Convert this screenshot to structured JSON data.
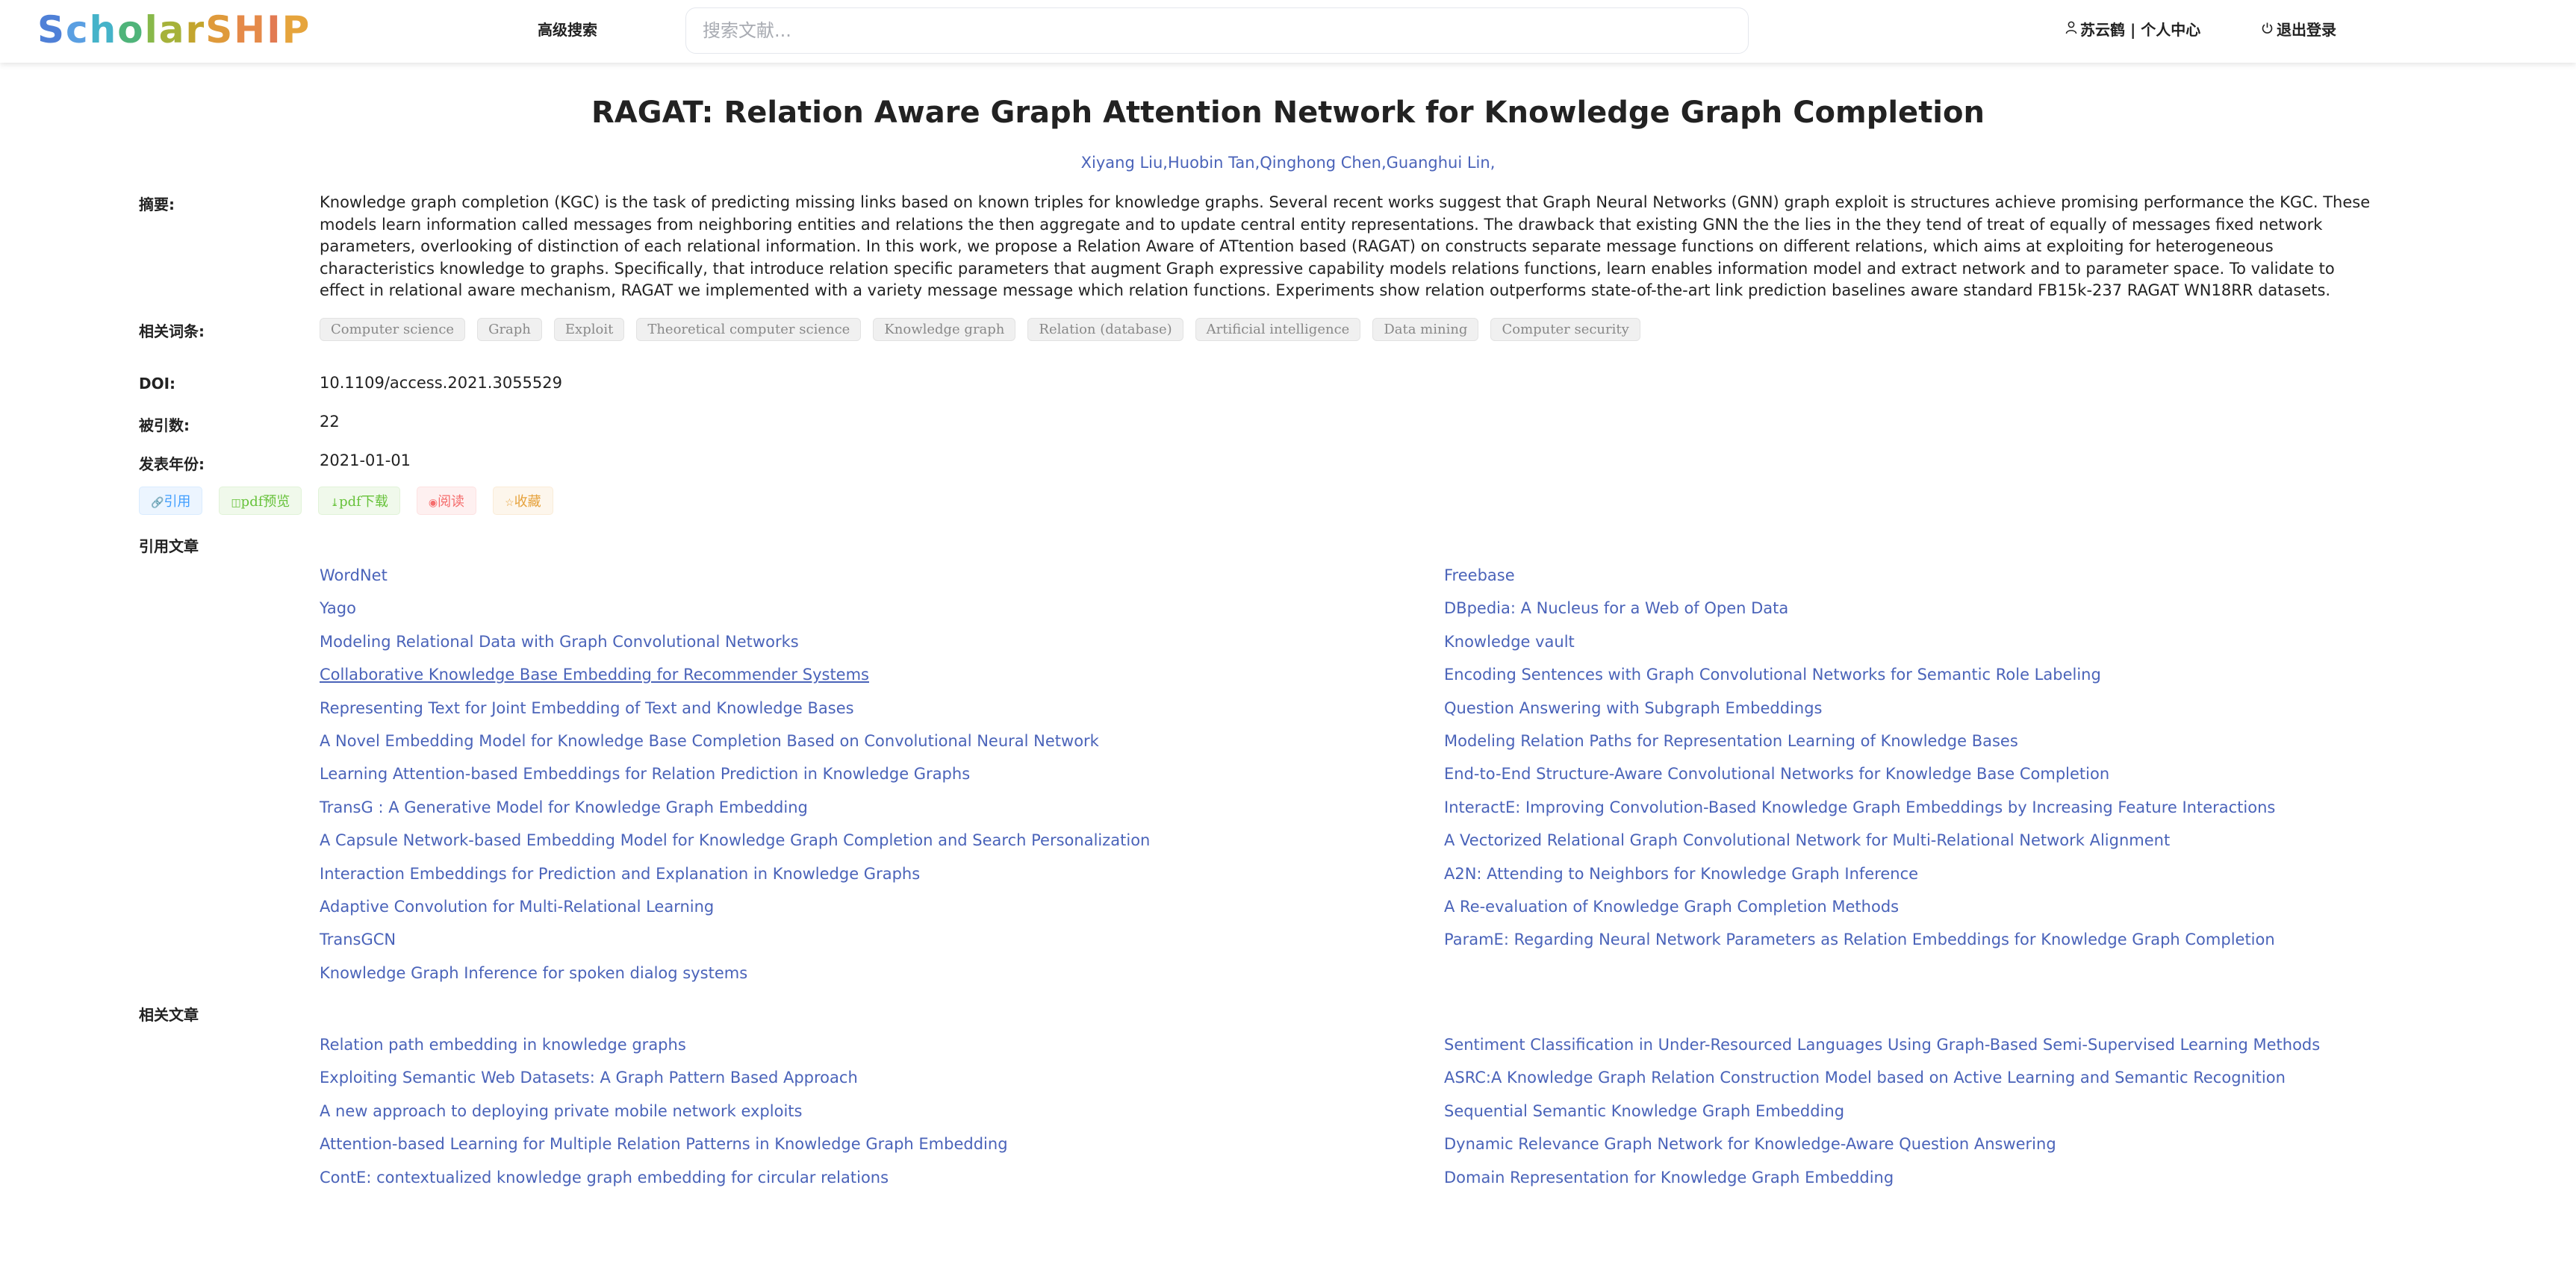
{
  "header": {
    "logo_letters": [
      {
        "ch": "S",
        "color": "#4f80d7"
      },
      {
        "ch": "c",
        "color": "#5a9fe2"
      },
      {
        "ch": "h",
        "color": "#45b3c9"
      },
      {
        "ch": "o",
        "color": "#4fb47a"
      },
      {
        "ch": "l",
        "color": "#88b94a"
      },
      {
        "ch": "a",
        "color": "#a6b23a"
      },
      {
        "ch": "r",
        "color": "#c3a52e"
      },
      {
        "ch": "S",
        "color": "#df9a3b"
      },
      {
        "ch": "H",
        "color": "#e58a49"
      },
      {
        "ch": "I",
        "color": "#e27a52"
      },
      {
        "ch": "P",
        "color": "#e6a43c"
      }
    ],
    "advanced_search": "高级搜索",
    "search_placeholder": "搜索文献...",
    "user_label": "苏云鹤 | 个人中心",
    "logout_label": "退出登录"
  },
  "paper": {
    "title": "RAGAT: Relation Aware Graph Attention Network for Knowledge Graph Completion",
    "authors": "Xiyang Liu,Huobin Tan,Qinghong Chen,Guanghui Lin,",
    "abstract_label": "摘要:",
    "abstract": "Knowledge graph completion (KGC) is the task of predicting missing links based on known triples for knowledge graphs. Several recent works suggest that Graph Neural Networks (GNN) graph exploit is structures achieve promising performance the KGC. These models learn information called messages from neighboring entities and relations the then aggregate and to update central entity representations. The drawback that existing GNN the the lies in the they tend of treat of equally of messages fixed network parameters, overlooking of distinction of each relational information. In this work, we propose a Relation Aware of ATtention based (RAGAT) on constructs separate message functions on different relations, which aims at exploiting for heterogeneous characteristics knowledge to graphs. Specifically, that introduce relation specific parameters that augment Graph expressive capability models relations functions, learn enables information model and extract network and to parameter space. To validate to effect in relational aware mechanism, RAGAT we implemented with a variety message message which relation functions. Experiments show relation outperforms state-of-the-art link prediction baselines aware standard FB15k-237 RAGAT WN18RR datasets.",
    "keywords_label": "相关词条:",
    "keywords": [
      "Computer science",
      "Graph",
      "Exploit",
      "Theoretical computer science",
      "Knowledge graph",
      "Relation (database)",
      "Artificial intelligence",
      "Data mining",
      "Computer security"
    ],
    "doi_label": "DOI:",
    "doi": "10.1109/access.2021.3055529",
    "cited_label": "被引数:",
    "cited": "22",
    "year_label": "发表年份:",
    "year": "2021-01-01"
  },
  "actions": [
    {
      "icon": "🔗",
      "label": "引用",
      "name": "cite-button",
      "color": "#409eff",
      "bg": "#ecf5ff",
      "border": "#d9ecff"
    },
    {
      "icon": "◫",
      "label": "pdf预览",
      "name": "pdf-preview-button",
      "color": "#67c23a",
      "bg": "#f0f9eb",
      "border": "#e1f3d8"
    },
    {
      "icon": "⤓",
      "label": "pdf下载",
      "name": "pdf-download-button",
      "color": "#67c23a",
      "bg": "#f0f9eb",
      "border": "#e1f3d8"
    },
    {
      "icon": "◉",
      "label": "阅读",
      "name": "read-button",
      "color": "#f56c6c",
      "bg": "#fef0f0",
      "border": "#fde2e2"
    },
    {
      "icon": "☆",
      "label": "收藏",
      "name": "favorite-button",
      "color": "#e6a23c",
      "bg": "#fdf6ec",
      "border": "#faecd8"
    }
  ],
  "references_label": "引用文章",
  "references": [
    "WordNet",
    "Freebase",
    "Yago",
    "DBpedia: A Nucleus for a Web of Open Data",
    "Modeling Relational Data with Graph Convolutional Networks",
    "Knowledge vault",
    "Collaborative Knowledge Base Embedding for Recommender Systems",
    "Encoding Sentences with Graph Convolutional Networks for Semantic Role Labeling",
    "Representing Text for Joint Embedding of Text and Knowledge Bases",
    "Question Answering with Subgraph Embeddings",
    "A Novel Embedding Model for Knowledge Base Completion Based on Convolutional Neural Network",
    "Modeling Relation Paths for Representation Learning of Knowledge Bases",
    "Learning Attention-based Embeddings for Relation Prediction in Knowledge Graphs",
    "End-to-End Structure-Aware Convolutional Networks for Knowledge Base Completion",
    "TransG : A Generative Model for Knowledge Graph Embedding",
    "InteractE: Improving Convolution-Based Knowledge Graph Embeddings by Increasing Feature Interactions",
    "A Capsule Network-based Embedding Model for Knowledge Graph Completion and Search Personalization",
    "A Vectorized Relational Graph Convolutional Network for Multi-Relational Network Alignment",
    "Interaction Embeddings for Prediction and Explanation in Knowledge Graphs",
    "A2N: Attending to Neighbors for Knowledge Graph Inference",
    "Adaptive Convolution for Multi-Relational Learning",
    "A Re-evaluation of Knowledge Graph Completion Methods",
    "TransGCN",
    "ParamE: Regarding Neural Network Parameters as Relation Embeddings for Knowledge Graph Completion",
    "Knowledge Graph Inference for spoken dialog systems"
  ],
  "related_label": "相关文章",
  "related": [
    "Relation path embedding in knowledge graphs",
    "Sentiment Classification in Under-Resourced Languages Using Graph-Based Semi-Supervised Learning Methods",
    "Exploiting Semantic Web Datasets: A Graph Pattern Based Approach",
    "ASRC:A Knowledge Graph Relation Construction Model based on Active Learning and Semantic Recognition",
    "A new approach to deploying private mobile network exploits",
    "Sequential Semantic Knowledge Graph Embedding",
    "Attention-based Learning for Multiple Relation Patterns in Knowledge Graph Embedding",
    "Dynamic Relevance Graph Network for Knowledge-Aware Question Answering",
    "ContE: contextualized knowledge graph embedding for circular relations",
    "Domain Representation for Knowledge Graph Embedding"
  ]
}
